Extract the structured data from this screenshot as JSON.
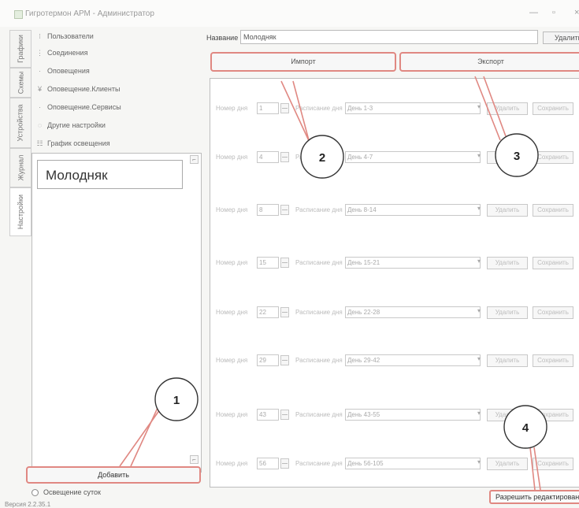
{
  "window": {
    "title": "Гигротермон АРМ - Администратор",
    "minimize_icon": "minimize-icon",
    "maximize_icon": "maximize-icon",
    "close_icon": "close-icon"
  },
  "vertical_tabs": [
    {
      "label": "Графики"
    },
    {
      "label": "Схемы"
    },
    {
      "label": "Устройства"
    },
    {
      "label": "Журнал"
    },
    {
      "label": "Настройки"
    }
  ],
  "nav_items": [
    {
      "label": "Пользователи",
      "icon": "users-icon"
    },
    {
      "label": "Соединения",
      "icon": "connections-icon"
    },
    {
      "label": "Оповещения",
      "icon": "alerts-icon"
    },
    {
      "label": "Оповещение.Клиенты",
      "icon": "client-alert-icon"
    },
    {
      "label": "Оповещение.Сервисы",
      "icon": "service-alert-icon"
    },
    {
      "label": "Другие настройки",
      "icon": "settings-icon"
    },
    {
      "label": "График освещения",
      "icon": "lighting-chart-icon"
    }
  ],
  "profiles": [
    {
      "name": "Молодняк"
    }
  ],
  "left_panel": {
    "add_button": "Добавить",
    "day_lighting": "Освещение суток",
    "version": "Версия 2.2.35.1"
  },
  "header": {
    "name_label": "Название",
    "name_value": "Молодняк",
    "delete_label": "Удалить",
    "import_label": "Импорт",
    "export_label": "Экспорт"
  },
  "schedule_labels": {
    "day_number": "Номер дня",
    "day_schedule": "Расписание дня",
    "delete": "Удалить",
    "save": "Сохранить"
  },
  "schedule_rows": [
    {
      "day": "1",
      "schedule": "День 1-3"
    },
    {
      "day": "4",
      "schedule": "День 4-7"
    },
    {
      "day": "8",
      "schedule": "День 8-14"
    },
    {
      "day": "15",
      "schedule": "День 15-21"
    },
    {
      "day": "22",
      "schedule": "День 22-28"
    },
    {
      "day": "29",
      "schedule": "День 29-42"
    },
    {
      "day": "43",
      "schedule": "День 43-55"
    },
    {
      "day": "56",
      "schedule": "День 56-105"
    }
  ],
  "allow_edit_label": "Разрешить редактирование",
  "callouts": [
    "1",
    "2",
    "3",
    "4"
  ],
  "colors": {
    "highlight": "#e08882",
    "callout_line": "#e08882"
  }
}
